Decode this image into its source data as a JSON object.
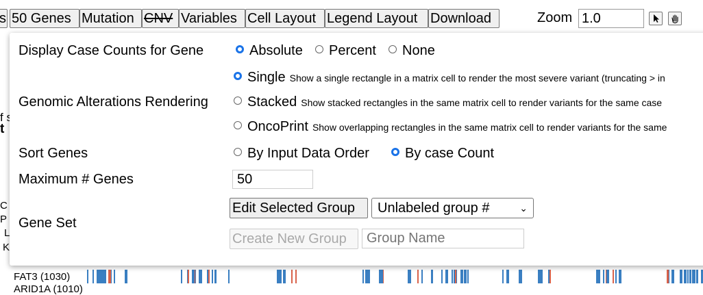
{
  "toolbar": {
    "buttons": [
      "s",
      "50 Genes",
      "Mutation",
      "CNV",
      "Variables",
      "Cell Layout",
      "Legend Layout",
      "Download"
    ],
    "zoom_label": "Zoom",
    "zoom_value": "1.0"
  },
  "background": {
    "frag_s": "f s",
    "frag_t": "t",
    "frag_c": "C",
    "frag_p": "P",
    "frag_l": "L",
    "frag_k": "K",
    "gene_row": "FAT3 (1030)",
    "gene_row_partial": "ARID1A (1010)"
  },
  "panel": {
    "case_counts": {
      "label": "Display Case Counts for Gene",
      "options": [
        "Absolute",
        "Percent",
        "None"
      ],
      "selected": "Absolute"
    },
    "rendering": {
      "label": "Genomic Alterations Rendering",
      "options": [
        {
          "name": "Single",
          "desc": "Show a single rectangle in a matrix cell to render the most severe variant (truncating > in",
          "selected": true
        },
        {
          "name": "Stacked",
          "desc": "Show stacked rectangles in the same matrix cell to render variants for the same case",
          "selected": false
        },
        {
          "name": "OncoPrint",
          "desc": "Show overlapping rectangles in the same matrix cell to render variants for the same",
          "selected": false
        }
      ]
    },
    "sort_genes": {
      "label": "Sort Genes",
      "options": [
        "By Input Data Order",
        "By case Count"
      ],
      "selected": "By case Count"
    },
    "max_genes": {
      "label": "Maximum # Genes",
      "value": "50"
    },
    "gene_set": {
      "label": "Gene Set",
      "edit_button": "Edit Selected Group",
      "group_select": "Unlabeled group #",
      "create_button": "Create New Group",
      "name_placeholder": "Group Name"
    }
  },
  "colors": {
    "radio_selected": "#1a73e8",
    "track_blue": "#3a7fc2",
    "track_red": "#d9634b"
  }
}
